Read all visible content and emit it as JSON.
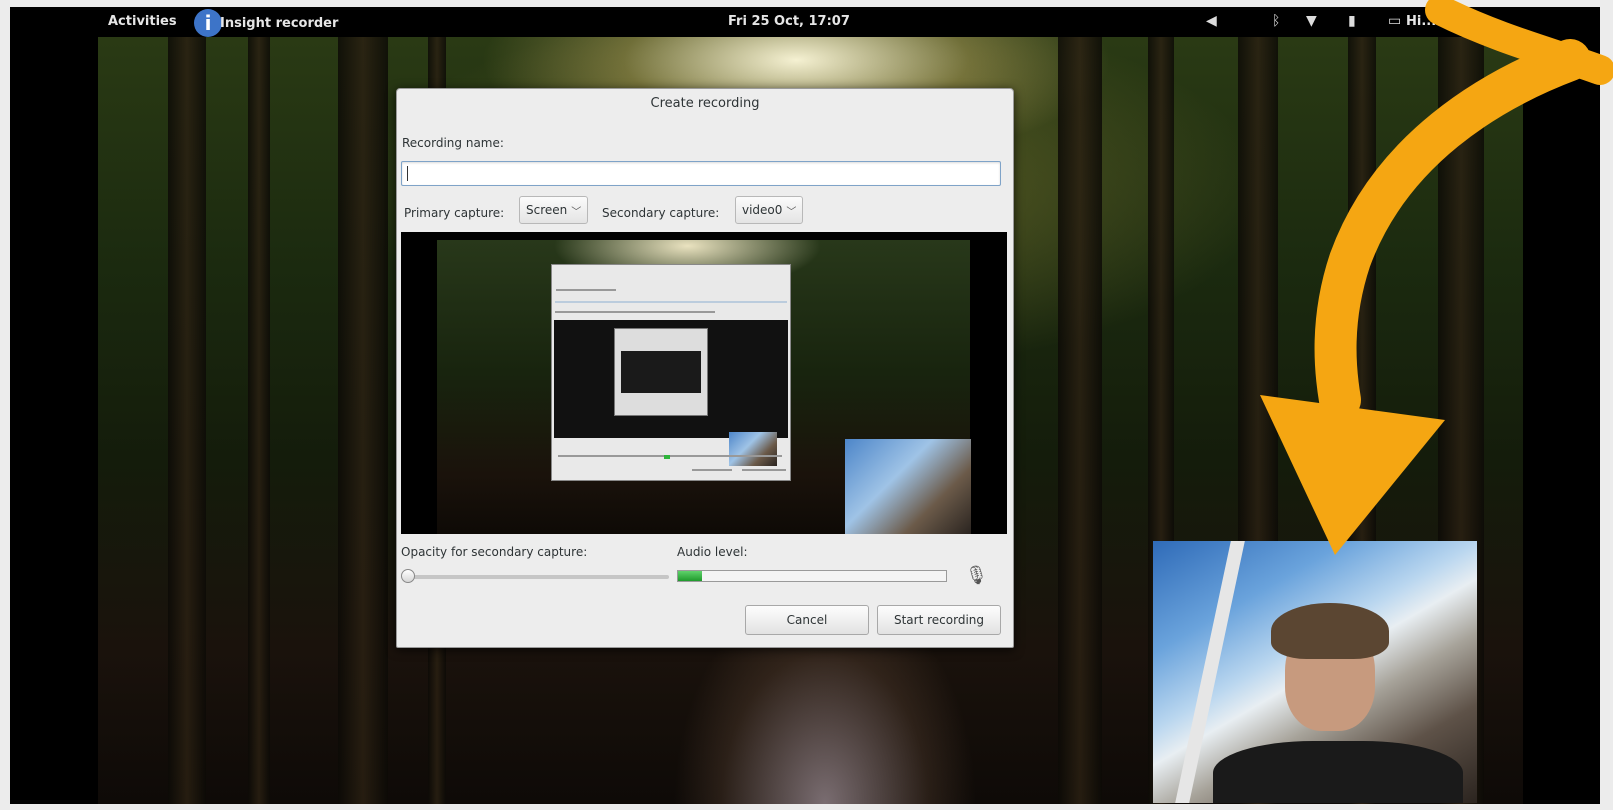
{
  "topbar": {
    "activities": "Activities",
    "app_name": "Insight recorder",
    "clock": "Fri 25 Oct, 17:07",
    "user_partial": "Hi..."
  },
  "dialog": {
    "title": "Create recording",
    "name_label": "Recording name:",
    "name_value": "",
    "primary_label": "Primary capture:",
    "primary_value": "Screen",
    "secondary_label": "Secondary capture:",
    "secondary_value": "video0",
    "opacity_label": "Opacity for secondary capture:",
    "opacity_value": 0.0,
    "audio_label": "Audio level:",
    "audio_level": 0.09,
    "cancel_label": "Cancel",
    "start_label": "Start recording"
  },
  "icons": {
    "accessibility": "accessibility-icon",
    "volume": "volume-icon",
    "bluetooth": "bluetooth-icon",
    "network": "network-icon",
    "battery": "battery-icon",
    "chat": "chat-icon",
    "microphone": "microphone-icon",
    "dropdown": "chevron-down-icon"
  },
  "colors": {
    "arrow": "#f5a612",
    "accent_blue": "#3d74c8",
    "level_green": "#2fb53c"
  }
}
